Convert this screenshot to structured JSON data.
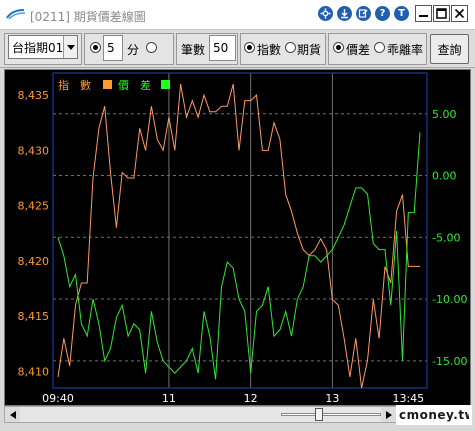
{
  "window": {
    "title": "[0211] 期貨價差線圖",
    "controls": [
      "settings-icon",
      "download-icon",
      "edit-icon",
      "help-icon",
      "minimize-icon",
      "close-icon"
    ]
  },
  "toolbar": {
    "contract_select": "台指期01",
    "period_value": "5",
    "period_unit": "分",
    "count_label": "筆數",
    "count_value": "50",
    "opt_index": "指數",
    "opt_futures": "期貨",
    "opt_spread": "價差",
    "opt_deviation": "乖離率",
    "query_button": "查詢"
  },
  "legend": {
    "index_label": "指　數",
    "spread_label": "價　差"
  },
  "colors": {
    "index_line": "#ff9966",
    "spread_line": "#33e633",
    "spread_swatch": "#22ff22",
    "index_swatch": "#ff9933",
    "frame": "#1a3aa0",
    "grid_dashed": "#707070",
    "left_axis_text": "#ff9933",
    "right_axis_text": "#33e633"
  },
  "chart_data": {
    "type": "line",
    "title": "",
    "left_axis": {
      "ticks": [
        "8,435",
        "8,430",
        "8,425",
        "8,420",
        "8,415",
        "8,410"
      ],
      "range": [
        8408.5,
        8437
      ]
    },
    "right_axis": {
      "ticks": [
        "5.00",
        "0.00",
        "-5.00",
        "-10.00",
        "-15.00"
      ],
      "range": [
        -17.2,
        8.3
      ]
    },
    "x_labels": [
      "09:40",
      "11",
      "12",
      "13",
      "13:45"
    ],
    "grid": "dashed horizontal and vertical",
    "series": [
      {
        "name": "指數",
        "axis": "left",
        "values": [
          8409.5,
          8413,
          8410.5,
          8416,
          8418,
          8418,
          8427.5,
          8432,
          8434,
          8428,
          8423,
          8428,
          8427.5,
          8427.5,
          8432,
          8430,
          8434,
          8431,
          8430,
          8433,
          8430,
          8436,
          8433,
          8434.5,
          8433,
          8435,
          8433.5,
          8433.5,
          8434,
          8434,
          8436,
          8430,
          8434.5,
          8434.5,
          8435,
          8430,
          8430,
          8432.5,
          8431,
          8426,
          8424.5,
          8422.5,
          8421,
          8420.5,
          8421,
          8422,
          8421,
          8416.5,
          8416,
          8413,
          8409.5,
          8413,
          8408.5,
          8411,
          8416.5,
          8413,
          8419.5,
          8418,
          8424.5,
          8426,
          8419.5,
          8419.5,
          8419.5
        ]
      },
      {
        "name": "價差",
        "axis": "right",
        "values": [
          -5,
          -6.5,
          -9,
          -8,
          -12,
          -13,
          -10,
          -12,
          -15,
          -14,
          -11.5,
          -10.5,
          -13,
          -12,
          -12.5,
          -16,
          -11,
          -13.5,
          -15,
          -15.5,
          -16,
          -15.5,
          -15,
          -14,
          -16,
          -11,
          -13,
          -16.5,
          -9,
          -7,
          -7.5,
          -10,
          -11,
          -16,
          -11,
          -10.5,
          -9,
          -13,
          -12.5,
          -11,
          -13,
          -10,
          -9,
          -6.5,
          -6.5,
          -7,
          -6.5,
          -6,
          -5,
          -4,
          -2.5,
          -1,
          -1,
          -1.5,
          -5.5,
          -6,
          -6,
          -10.5,
          -4.5,
          -15,
          -3,
          -3,
          3.5
        ]
      }
    ]
  }
}
